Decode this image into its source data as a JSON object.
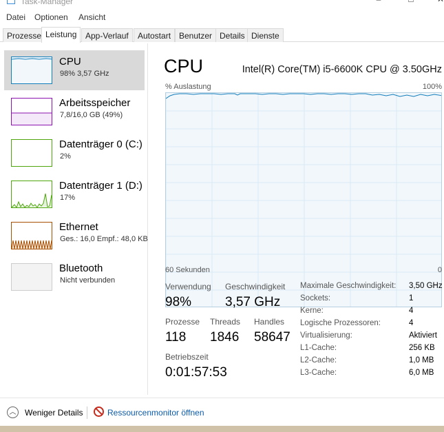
{
  "window": {
    "title": "Task-Manager"
  },
  "menu": [
    "Datei",
    "Optionen",
    "Ansicht"
  ],
  "tabs": [
    "Prozesse",
    "Leistung",
    "App-Verlauf",
    "Autostart",
    "Benutzer",
    "Details",
    "Dienste"
  ],
  "active_tab": "Leistung",
  "sidebar": {
    "items": [
      {
        "name": "CPU",
        "sub": "98%  3,57 GHz",
        "color": "#117dbb"
      },
      {
        "name": "Arbeitsspeicher",
        "sub": "7,8/16,0 GB (49%)",
        "color": "#8b12ae"
      },
      {
        "name": "Datenträger 0 (C:)",
        "sub": "2%",
        "color": "#4da60c"
      },
      {
        "name": "Datenträger 1 (D:)",
        "sub": "17%",
        "color": "#4da60c"
      },
      {
        "name": "Ethernet",
        "sub": "Ges.: 16,0  Empf.: 48,0 KB",
        "color": "#a74f01"
      },
      {
        "name": "Bluetooth",
        "sub": "Nicht verbunden",
        "color": "#bbbbbb"
      }
    ]
  },
  "main": {
    "title": "CPU",
    "cpu_model": "Intel(R) Core(TM) i5-6600K CPU @ 3.50GHz",
    "graph": {
      "y_label": "% Auslastung",
      "y_max_label": "100%",
      "x_label": "60 Sekunden",
      "x_min_label": "0",
      "line_color": "#117dbb",
      "fill_color": "#f1f7fb",
      "grid_color": "#d9eaf4"
    },
    "stats": {
      "usage_label": "Verwendung",
      "usage_value": "98%",
      "speed_label": "Geschwindigkeit",
      "speed_value": "3,57 GHz",
      "processes_label": "Prozesse",
      "processes_value": "118",
      "threads_label": "Threads",
      "threads_value": "1846",
      "handles_label": "Handles",
      "handles_value": "58647",
      "uptime_label": "Betriebszeit",
      "uptime_value": "0:01:57:53"
    },
    "details": [
      {
        "label": "Maximale Geschwindigkeit:",
        "value": "3,50 GHz"
      },
      {
        "label": "Sockets:",
        "value": "1"
      },
      {
        "label": "Kerne:",
        "value": "4"
      },
      {
        "label": "Logische Prozessoren:",
        "value": "4"
      },
      {
        "label": "Virtualisierung:",
        "value": "Aktiviert"
      },
      {
        "label": "L1-Cache:",
        "value": "256 KB"
      },
      {
        "label": "L2-Cache:",
        "value": "1,0 MB"
      },
      {
        "label": "L3-Cache:",
        "value": "6,0 MB"
      }
    ]
  },
  "footer": {
    "less_details": "Weniger Details",
    "resource_monitor": "Ressourcenmonitor öffnen"
  }
}
